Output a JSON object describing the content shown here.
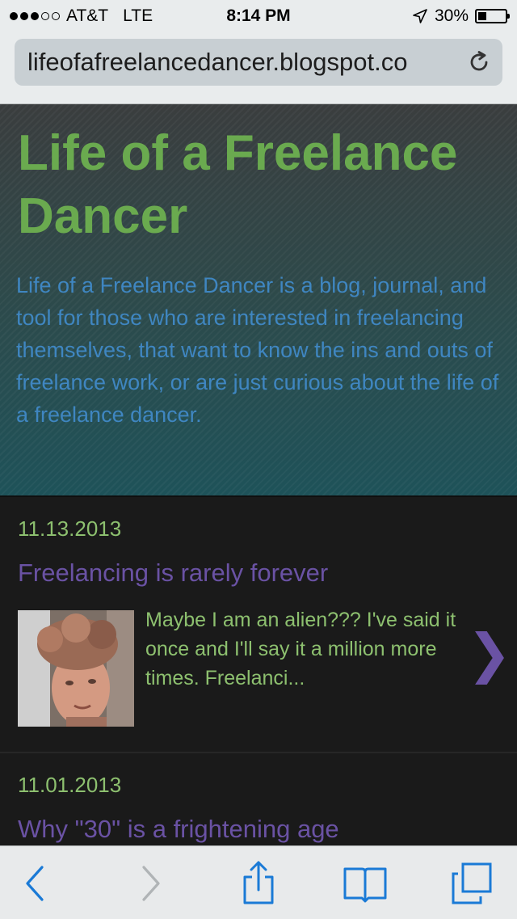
{
  "status_bar": {
    "carrier": "AT&T",
    "network": "LTE",
    "time": "8:14 PM",
    "battery_text": "30%",
    "battery_level": 0.3,
    "signal_bars": 3,
    "signal_total": 5
  },
  "url_bar": {
    "url": "lifeofafreelancedancer.blogspot.co"
  },
  "blog": {
    "title": "Life of a Freelance Dancer",
    "description": "Life of a Freelance Dancer is a blog, journal, and tool for those who are interested in freelancing themselves, that want to know the ins and outs of freelance work, or are just curious about the life of a freelance dancer."
  },
  "posts": [
    {
      "date": "11.13.2013",
      "title": "Freelancing is rarely forever",
      "snippet": "Maybe I am an alien??? I've said it once and I'll say it a million more times. Freelanci..."
    },
    {
      "date": "11.01.2013",
      "title": "Why \"30\" is a frightening age"
    }
  ],
  "icons": {
    "reload": "reload-icon",
    "chevron": "chevron-right-icon",
    "back": "back-arrow-icon",
    "forward": "forward-arrow-icon",
    "share": "share-icon",
    "bookmarks": "bookmarks-icon",
    "tabs": "tabs-icon"
  },
  "colors": {
    "title_green": "#6aaa4f",
    "description_blue": "#3f86c1",
    "post_title_purple": "#6a52a4",
    "date_green": "#8dc06f",
    "toolbar_blue": "#1a7ad6"
  }
}
